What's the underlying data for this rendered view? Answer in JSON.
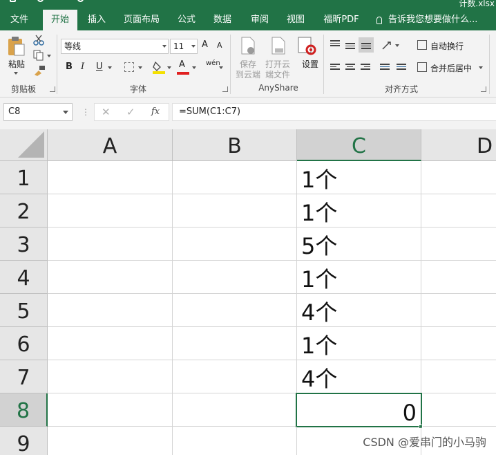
{
  "window": {
    "title_fragment": "计数.xlsx"
  },
  "tabs": [
    {
      "label": "文件"
    },
    {
      "label": "开始"
    },
    {
      "label": "插入"
    },
    {
      "label": "页面布局"
    },
    {
      "label": "公式"
    },
    {
      "label": "数据"
    },
    {
      "label": "审阅"
    },
    {
      "label": "视图"
    },
    {
      "label": "福昕PDF"
    }
  ],
  "active_tab": "开始",
  "tell_me": "告诉我您想要做什么...",
  "ribbon": {
    "clipboard": {
      "paste": "粘贴",
      "label": "剪贴板"
    },
    "font": {
      "name": "等线",
      "size": "11",
      "grow": "A",
      "shrink": "A",
      "bold": "B",
      "italic": "I",
      "underline": "U",
      "font_color_glyph": "A",
      "phonetic": "wén",
      "label": "字体",
      "colors": {
        "highlight": "#f4e000",
        "font_color": "#e02020"
      }
    },
    "anyshare": {
      "save_cloud_l1": "保存",
      "save_cloud_l2": "到云端",
      "open_cloud_l1": "打开云",
      "open_cloud_l2": "端文件",
      "settings": "设置",
      "label": "AnyShare"
    },
    "alignment": {
      "wrap_text": "自动换行",
      "merge_center": "合并后居中",
      "label": "对齐方式"
    }
  },
  "formula_bar": {
    "name_box": "C8",
    "cancel": "✕",
    "enter": "✓",
    "fx": "fx",
    "formula": "=SUM(C1:C7)"
  },
  "sheet": {
    "columns": [
      "A",
      "B",
      "C",
      "D"
    ],
    "selected_column": "C",
    "rows": [
      "1",
      "2",
      "3",
      "4",
      "5",
      "6",
      "7",
      "8",
      "9"
    ],
    "selected_row": "8",
    "column_c": [
      "1个",
      "1个",
      "5个",
      "1个",
      "4个",
      "1个",
      "4个",
      "0",
      ""
    ],
    "active_cell": "C8"
  },
  "watermark": "CSDN @爱串门的小马驹",
  "colors": {
    "accent": "#217346",
    "header_bg": "#e6e6e6",
    "ribbon_bg": "#f3f3f3"
  }
}
